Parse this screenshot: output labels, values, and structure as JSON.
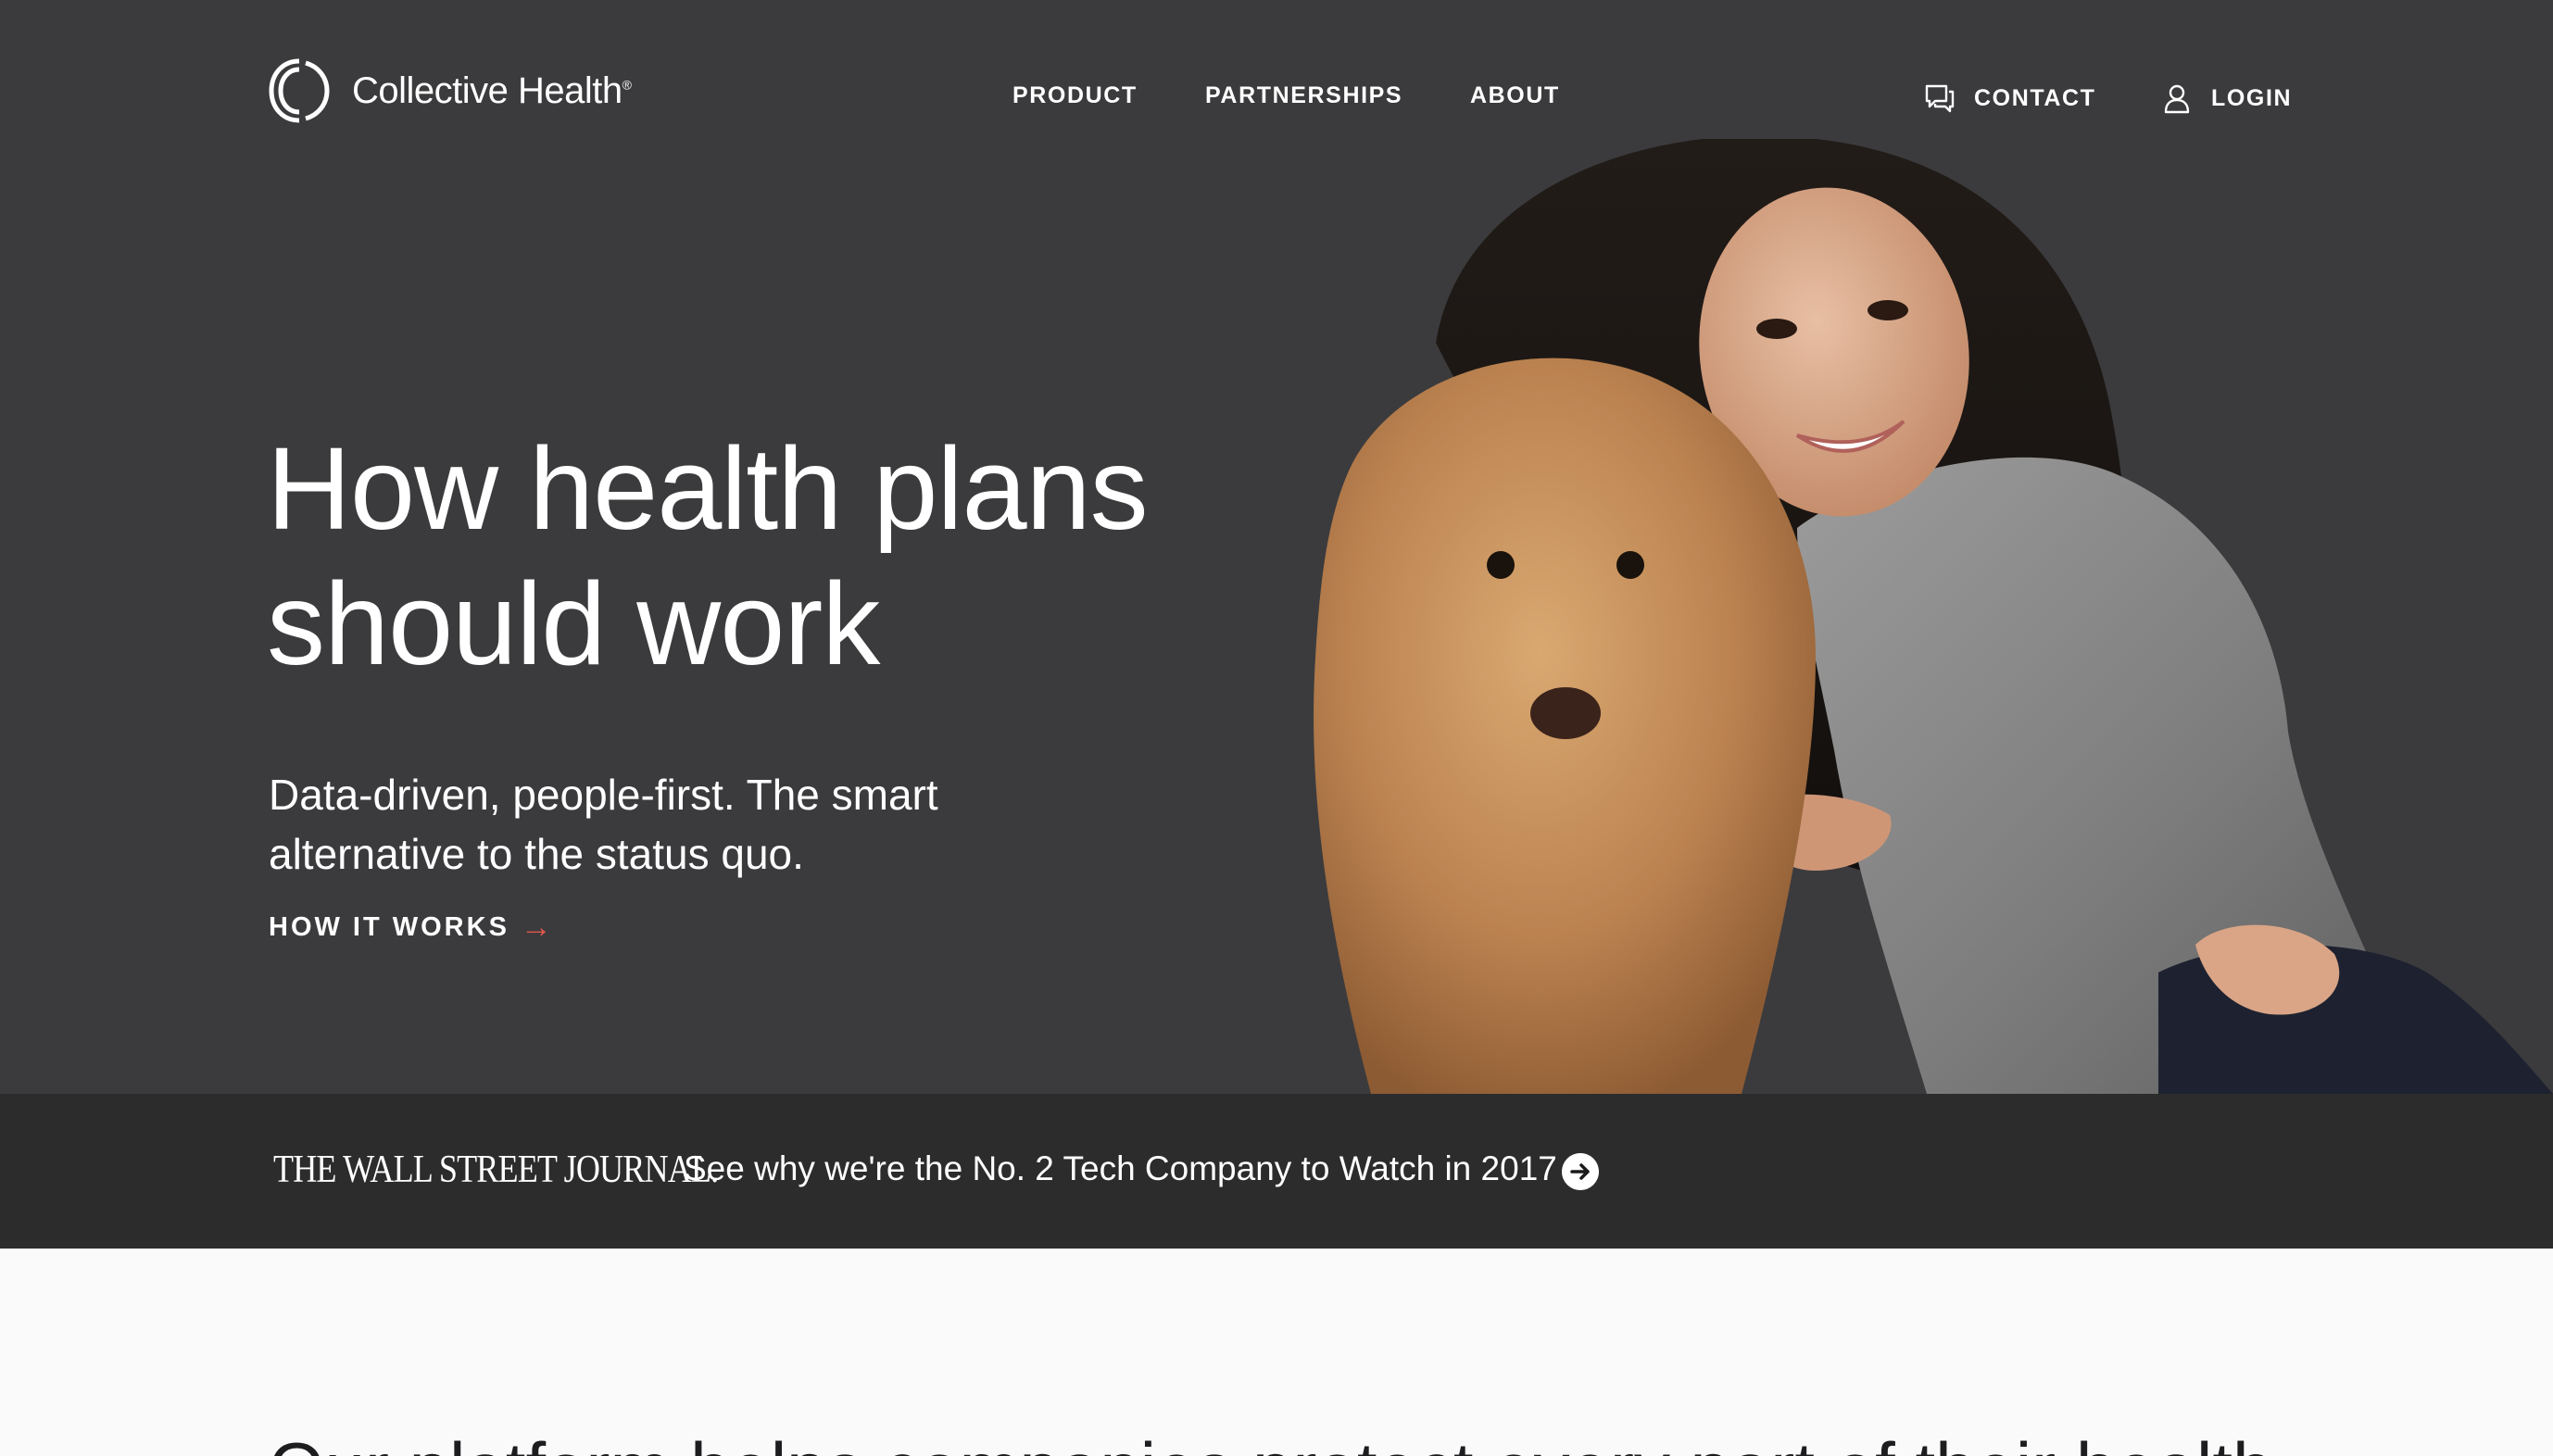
{
  "header": {
    "brand": "Collective Health",
    "brand_mark": "®",
    "nav": {
      "product": "PRODUCT",
      "partnerships": "PARTNERSHIPS",
      "about": "ABOUT",
      "contact": "CONTACT",
      "login": "LOGIN"
    },
    "icons": {
      "contact": "chat-bubble-icon",
      "login": "user-icon"
    }
  },
  "hero": {
    "headline_line1": "How health plans",
    "headline_line2": "should work",
    "subhead_line1": "Data-driven, people-first. The smart",
    "subhead_line2": "alternative to the status quo.",
    "cta": "HOW IT WORKS",
    "cta_arrow": "→",
    "colors": {
      "background": "#3b3b3d",
      "accent": "#e2574c"
    }
  },
  "press": {
    "publication": "THE WALL STREET JOURNAL.",
    "text": "See why we're the No. 2 Tech Company to Watch in 2017",
    "icon": "arrow-circle-right-icon"
  },
  "below": {
    "heading": "Our platform helps companies protect every part of their health"
  }
}
